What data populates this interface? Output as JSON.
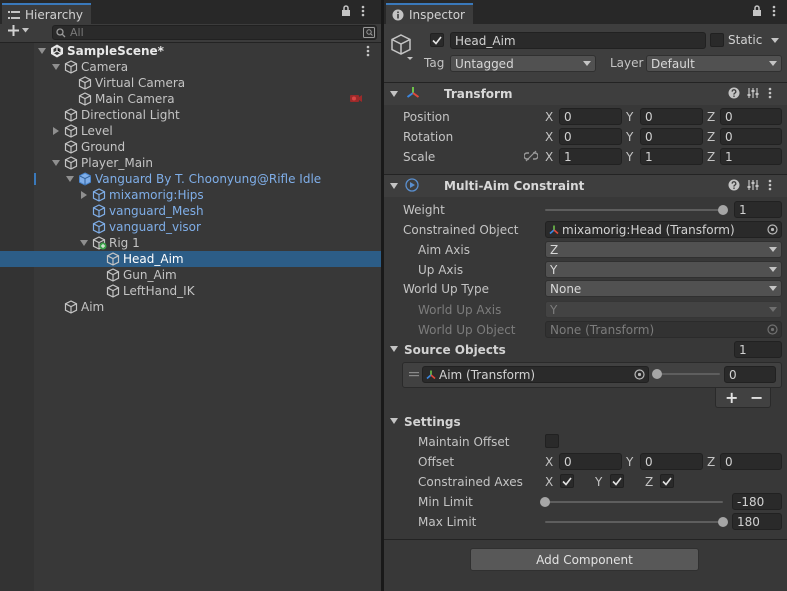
{
  "hierarchy": {
    "tab_label": "Hierarchy",
    "search_placeholder": "All",
    "items": [
      {
        "label": "SampleScene*",
        "depth": 0,
        "kind": "scene",
        "fold": "open"
      },
      {
        "label": "Camera",
        "depth": 1,
        "kind": "object",
        "fold": "open"
      },
      {
        "label": "Virtual Camera",
        "depth": 2,
        "kind": "object",
        "fold": "none"
      },
      {
        "label": "Main Camera",
        "depth": 2,
        "kind": "object",
        "fold": "none"
      },
      {
        "label": "Directional Light",
        "depth": 1,
        "kind": "object",
        "fold": "none"
      },
      {
        "label": "Level",
        "depth": 1,
        "kind": "object",
        "fold": "closed"
      },
      {
        "label": "Ground",
        "depth": 1,
        "kind": "object",
        "fold": "none"
      },
      {
        "label": "Player_Main",
        "depth": 1,
        "kind": "object",
        "fold": "open"
      },
      {
        "label": "Vanguard By T. Choonyung@Rifle Idle",
        "depth": 2,
        "kind": "prefab",
        "fold": "open"
      },
      {
        "label": "mixamorig:Hips",
        "depth": 3,
        "kind": "prefab",
        "fold": "closed"
      },
      {
        "label": "vanguard_Mesh",
        "depth": 3,
        "kind": "prefab",
        "fold": "none"
      },
      {
        "label": "vanguard_visor",
        "depth": 3,
        "kind": "prefab",
        "fold": "none"
      },
      {
        "label": "Rig 1",
        "depth": 3,
        "kind": "rig",
        "fold": "open"
      },
      {
        "label": "Head_Aim",
        "depth": 4,
        "kind": "object",
        "fold": "none",
        "selected": true
      },
      {
        "label": "Gun_Aim",
        "depth": 4,
        "kind": "object",
        "fold": "none"
      },
      {
        "label": "LeftHand_IK",
        "depth": 4,
        "kind": "object",
        "fold": "none"
      },
      {
        "label": "Aim",
        "depth": 1,
        "kind": "object",
        "fold": "none"
      }
    ]
  },
  "inspector": {
    "tab_label": "Inspector",
    "gameobject": {
      "active": true,
      "name": "Head_Aim",
      "static_label": "Static",
      "static": false,
      "tag_label": "Tag",
      "tag_value": "Untagged",
      "layer_label": "Layer",
      "layer_value": "Default"
    },
    "transform": {
      "title": "Transform",
      "rows": [
        {
          "label": "Position",
          "x": "0",
          "y": "0",
          "z": "0"
        },
        {
          "label": "Rotation",
          "x": "0",
          "y": "0",
          "z": "0"
        },
        {
          "label": "Scale",
          "x": "1",
          "y": "1",
          "z": "1"
        }
      ]
    },
    "multi_aim": {
      "title": "Multi-Aim Constraint",
      "weight_label": "Weight",
      "weight_value": "1",
      "weight_fraction": 1,
      "constrained_object_label": "Constrained Object",
      "constrained_object_value": "mixamorig:Head (Transform)",
      "aim_axis_label": "Aim Axis",
      "aim_axis_value": "Z",
      "up_axis_label": "Up Axis",
      "up_axis_value": "Y",
      "world_up_type_label": "World Up Type",
      "world_up_type_value": "None",
      "world_up_axis_label": "World Up Axis",
      "world_up_axis_value": "Y",
      "world_up_object_label": "World Up Object",
      "world_up_object_value": "None (Transform)",
      "source_objects_label": "Source Objects",
      "source_objects_count": "1",
      "source_item_label": "Aim (Transform)",
      "source_item_weight": "0",
      "source_item_weight_fraction": 0,
      "add_label": "+",
      "remove_label": "−",
      "settings_label": "Settings",
      "maintain_offset_label": "Maintain Offset",
      "maintain_offset": false,
      "offset_label": "Offset",
      "offset": {
        "x": "0",
        "y": "0",
        "z": "0"
      },
      "constrained_axes_label": "Constrained Axes",
      "constrained_axes": {
        "x": true,
        "y": true,
        "z": true
      },
      "min_limit_label": "Min Limit",
      "min_limit_value": "-180",
      "min_limit_fraction": 0,
      "max_limit_label": "Max Limit",
      "max_limit_value": "180",
      "max_limit_fraction": 1
    },
    "add_component_label": "Add Component"
  },
  "axis_letters": {
    "x": "X",
    "y": "Y",
    "z": "Z"
  },
  "colors": {
    "selection": "#2c5d87",
    "prefab_text": "#7faee8",
    "accent": "#3a79bb",
    "panel_bg": "#383838"
  }
}
